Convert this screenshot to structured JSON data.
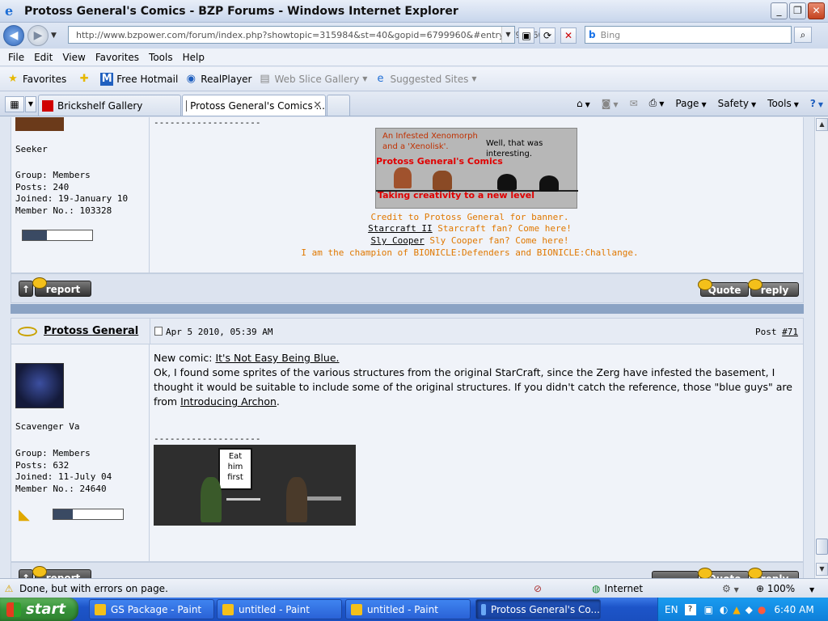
{
  "window": {
    "title": "Protoss General's Comics - BZP Forums - Windows Internet Explorer"
  },
  "address": {
    "url": "http://www.bzpower.com/forum/index.php?showtopic=315984&st=40&gopid=6799960&#entry6799960"
  },
  "search": {
    "placeholder": "Bing"
  },
  "menu": [
    "File",
    "Edit",
    "View",
    "Favorites",
    "Tools",
    "Help"
  ],
  "favbar": {
    "favorites": "Favorites",
    "items": [
      "Free Hotmail",
      "RealPlayer",
      "Web Slice Gallery",
      "Suggested Sites"
    ]
  },
  "tabs": [
    {
      "label": "Brickshelf Gallery"
    },
    {
      "label": "Protoss General's Comics ..."
    }
  ],
  "cmdbar": {
    "page": "Page",
    "safety": "Safety",
    "tools": "Tools"
  },
  "post1": {
    "member_title": "Seeker",
    "group": "Group: Members",
    "posts": "Posts: 240",
    "joined": "Joined: 19-January 10",
    "member_no": "Member No.: 103328",
    "dashes": "--------------------",
    "banner": {
      "caption1": "An Infested Xenomorph",
      "caption2": "and a 'Xenolisk'.",
      "speech1": "Well, that was",
      "speech2": "interesting.",
      "title": "Protoss General's Comics",
      "tagline": "Taking creativity to a new level"
    },
    "credit": "Credit to Protoss General for banner.",
    "sc2_link": "Starcraft II",
    "sc2_text": " Starcraft fan? Come here!",
    "sly_link": "Sly Cooper",
    "sly_text": " Sly Cooper fan? Come here!",
    "champion": "I am the champion of BIONICLE:Defenders and BIONICLE:Challange."
  },
  "buttons": {
    "report": "report",
    "quote": "Quote",
    "reply": "reply"
  },
  "post2": {
    "author": "Protoss General",
    "date": "Apr 5 2010, 05:39 AM",
    "post_label": "Post ",
    "post_num": "#71",
    "member_title": "Scavenger Va",
    "group": "Group: Members",
    "posts": "Posts: 632",
    "joined": "Joined: 11-July 04",
    "member_no": "Member No.: 24640",
    "body_lead": "New comic: ",
    "comic_link": "It's Not Easy Being Blue.",
    "body_main": "Ok, I found some sprites of the various structures from the original StarCraft, since the Zerg have infested the basement, I thought it would be suitable to include some of the original structures. If you didn't catch the reference, those \"blue guys\" are from ",
    "archon_link": "Introducing Archon",
    "body_end": ".",
    "dashes": "--------------------",
    "sign": {
      "l1": "Eat",
      "l2": "him",
      "l3": "first"
    }
  },
  "status": {
    "text": "Done, but with errors on page.",
    "zone": "Internet",
    "zoom": "100%"
  },
  "taskbar": {
    "start": "start",
    "items": [
      "GS Package - Paint",
      "untitled - Paint",
      "untitled - Paint",
      "Protoss General's Co..."
    ],
    "lang": "EN",
    "time": "6:40 AM"
  },
  "colors": {
    "orange": "#e07800",
    "banner_red": "#e00000",
    "separator": "#8ba3c4"
  }
}
